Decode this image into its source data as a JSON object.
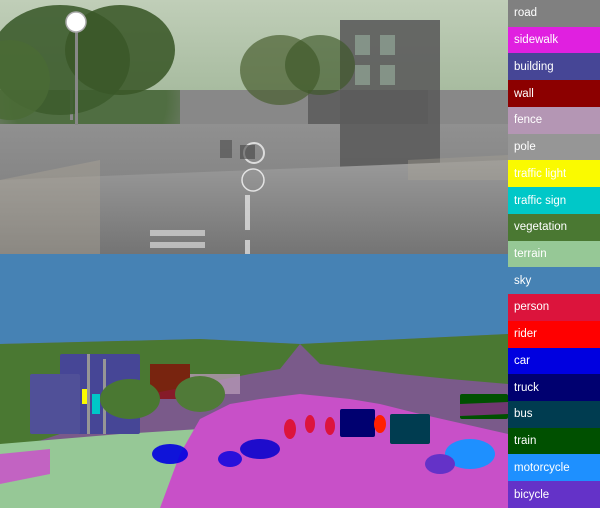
{
  "legend": {
    "items": [
      {
        "label": "road",
        "color": "#808080"
      },
      {
        "label": "sidewalk",
        "color": "#e020e0"
      },
      {
        "label": "building",
        "color": "#464696"
      },
      {
        "label": "wall",
        "color": "#8c0000"
      },
      {
        "label": "fence",
        "color": "#b496b4"
      },
      {
        "label": "pole",
        "color": "#969696"
      },
      {
        "label": "traffic light",
        "color": "#fafa00"
      },
      {
        "label": "traffic sign",
        "color": "#00c8c8"
      },
      {
        "label": "vegetation",
        "color": "#4a7832"
      },
      {
        "label": "terrain",
        "color": "#96c896"
      },
      {
        "label": "sky",
        "color": "#4682b4"
      },
      {
        "label": "person",
        "color": "#dc143c"
      },
      {
        "label": "rider",
        "color": "#ff0000"
      },
      {
        "label": "car",
        "color": "#0000e0"
      },
      {
        "label": "truck",
        "color": "#000070"
      },
      {
        "label": "bus",
        "color": "#003c50"
      },
      {
        "label": "train",
        "color": "#005000"
      },
      {
        "label": "motorcycle",
        "color": "#1e90ff"
      },
      {
        "label": "bicycle",
        "color": "#6432c8"
      }
    ]
  }
}
